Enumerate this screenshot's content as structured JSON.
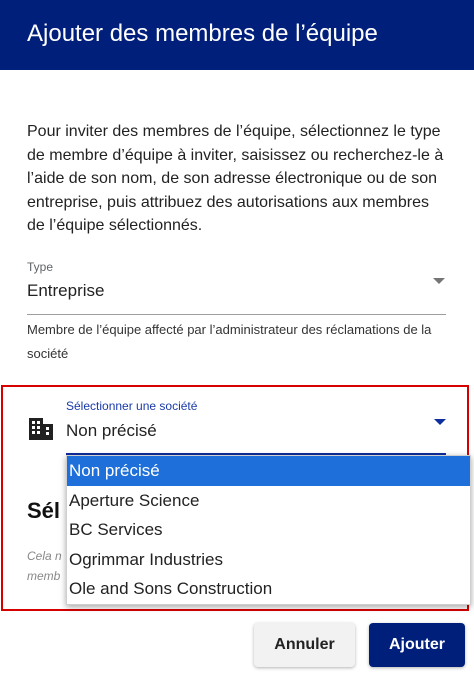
{
  "dialog": {
    "title": "Ajouter des membres de l’équipe",
    "intro": "Pour inviter des membres de l’équipe, sélectionnez le type de membre d’équipe à inviter, saisissez ou recherchez-le à l’aide de son nom, de son adresse électronique ou de son entreprise, puis attribuez des autorisations aux membres de l’équipe sélectionnés."
  },
  "type_field": {
    "label": "Type",
    "value": "Entreprise",
    "icon": "arrow-drop-down-icon",
    "help": "Membre de l’équipe affecté par l’administrateur des réclamations de la société"
  },
  "company_field": {
    "icon": "building-icon",
    "label": "Sélectionner une société",
    "value": "Non précisé",
    "caret_icon": "arrow-drop-down-icon",
    "options": [
      "Non précisé",
      "Aperture Science",
      "BC Services",
      "Ogrimmar Industries",
      "Ole and Sons Construction"
    ],
    "selected_index": 0
  },
  "obscured": {
    "heading": "Sél",
    "help_line1": "Cela n",
    "help_line2": "memb"
  },
  "actions": {
    "cancel_label": "Annuler",
    "add_label": "Ajouter"
  },
  "colors": {
    "header_bg": "#001f7a",
    "accent": "#0d2d9c",
    "highlight_border": "#d60000",
    "selected_option_bg": "#1e6fd9"
  }
}
